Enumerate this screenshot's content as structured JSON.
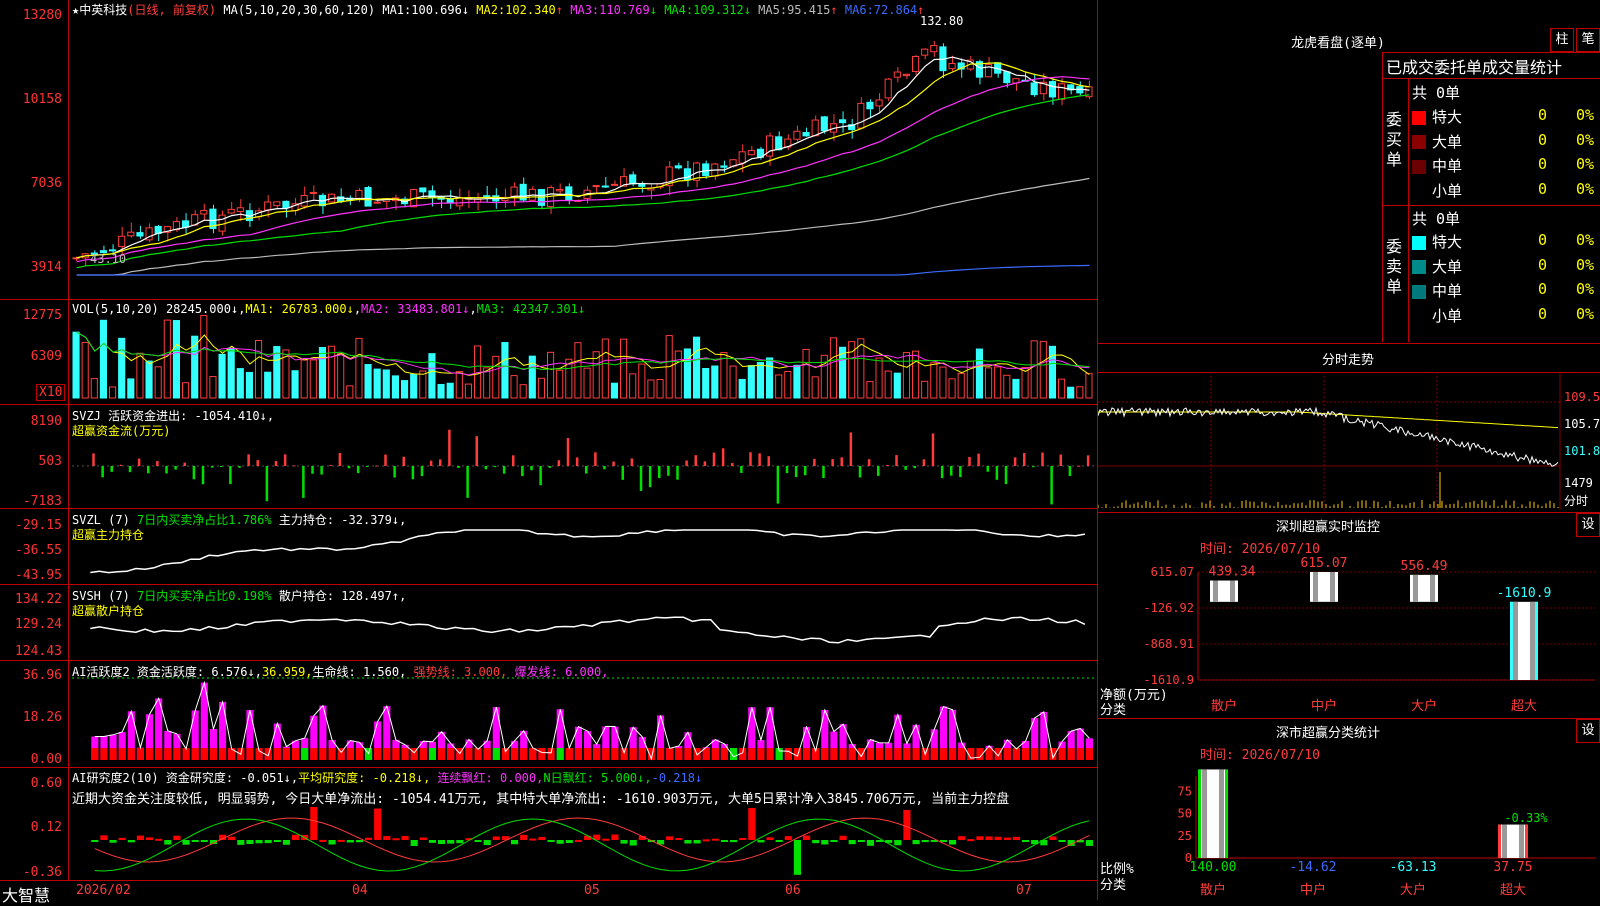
{
  "main": {
    "star": "★",
    "title": "中英科技",
    "period": "(日线, 前复权)",
    "ma_label": "MA(5,10,20,30,60,120)",
    "ma": [
      {
        "label": "MA1:",
        "value": "100.696",
        "arrow": "↓",
        "color": "#ffffff"
      },
      {
        "label": "MA2:",
        "value": "102.340",
        "arrow": "↑",
        "color": "#ffff00"
      },
      {
        "label": "MA3:",
        "value": "110.769",
        "arrow": "↓",
        "color": "#ff33ff"
      },
      {
        "label": "MA4:",
        "value": "109.312",
        "arrow": "↓",
        "color": "#00e000"
      },
      {
        "label": "MA5:",
        "value": "95.415",
        "arrow": "↑",
        "color": "#bbbbbb"
      },
      {
        "label": "MA6:",
        "value": "72.864",
        "arrow": "↑",
        "color": "#3b6bff"
      }
    ],
    "y_ticks": [
      "13280",
      "10158",
      "7036",
      "3914"
    ],
    "high_label": "132.80",
    "low_label": "43.10"
  },
  "vol": {
    "label": "VOL(5,10,20)",
    "value": "28245.000↓",
    "ma": [
      {
        "label": "MA1:",
        "value": "26783.000↓",
        "color": "#ffff00"
      },
      {
        "label": "MA2:",
        "value": "33483.801↓",
        "color": "#ff33ff"
      },
      {
        "label": "MA3:",
        "value": "42347.301↓",
        "color": "#00e000"
      }
    ],
    "y_ticks": [
      "12775",
      "6309"
    ],
    "unit": "X10"
  },
  "svzj": {
    "label": "SVZJ",
    "text": "活跃资金进出: -1054.410↓,",
    "sub": "超赢资金流(万元)",
    "y_ticks": [
      "8190",
      "503",
      "-7183"
    ]
  },
  "svzl": {
    "label": "SVZL (7)",
    "pct": "7日内买卖净占比1.786%",
    "hold": "主力持仓: -32.379↓,",
    "sub": "超赢主力持仓",
    "y_ticks": [
      "-29.15",
      "-36.55",
      "-43.95"
    ]
  },
  "svsh": {
    "label": "SVSH (7)",
    "pct": "7日内买卖净占比0.198%",
    "hold": "散户持仓: 128.497↑,",
    "sub": "超赢散户持仓",
    "y_ticks": [
      "134.22",
      "129.24",
      "124.43"
    ]
  },
  "ai1": {
    "label": "AI活跃度2",
    "text": "资金活跃度: 6.576↓,",
    "v2": "36.959,",
    "life": "生命线: 1.560,",
    "strong": "强势线: 3.000,",
    "burst": "爆发线: 6.000,",
    "y_ticks": [
      "36.96",
      "18.26",
      "0.00"
    ]
  },
  "ai2": {
    "label": "AI研究度2(10)",
    "t1": "资金研究度: -0.051↓,",
    "t2": "平均研究度: -0.218↓,",
    "t3": "连续飘红: 0.000,",
    "t4": "N日飘红: 5.000↓,",
    "t5": "-0.218↓",
    "comment": "近期大资金关注度较低, 明显弱势, 今日大单净流出: -1054.41万元, 其中特大单净流出: -1610.903万元, 大单5日累计净入3845.706万元, 当前主力控盘",
    "y_ticks": [
      "0.60",
      "0.12",
      "-0.36"
    ]
  },
  "xaxis": {
    "brand": "大智慧",
    "labels": [
      "2026/02",
      "04",
      "05",
      "06",
      "07"
    ]
  },
  "right": {
    "lhb": {
      "title": "龙虎看盘(逐单)",
      "btn1": "柱",
      "btn2": "笔",
      "header": "已成交委托单成交量统计",
      "buy": {
        "label": "委买单",
        "total": "共 0单",
        "rows": [
          {
            "name": "特大",
            "v": "0",
            "p": "0%",
            "color": "#ff0000"
          },
          {
            "name": "大单",
            "v": "0",
            "p": "0%",
            "color": "#8b0000"
          },
          {
            "name": "中单",
            "v": "0",
            "p": "0%",
            "color": "#6b0000"
          },
          {
            "name": "小单",
            "v": "0",
            "p": "0%",
            "color": "#000000"
          }
        ]
      },
      "sell": {
        "label": "委卖单",
        "total": "共 0单",
        "rows": [
          {
            "name": "特大",
            "v": "0",
            "p": "0%",
            "color": "#00ffff"
          },
          {
            "name": "大单",
            "v": "0",
            "p": "0%",
            "color": "#008b8b"
          },
          {
            "name": "中单",
            "v": "0",
            "p": "0%",
            "color": "#007a7a"
          },
          {
            "name": "小单",
            "v": "0",
            "p": "0%",
            "color": "#000000"
          }
        ]
      }
    },
    "fs": {
      "title": "分时走势",
      "ticks": [
        "109.5",
        "105.7",
        "101.8"
      ],
      "vol": "1479",
      "vol_unit": "分时"
    },
    "monitor": {
      "title": "深圳超赢实时监控",
      "btn": "设",
      "time": "时间: 2026/07/10",
      "y_ticks": [
        "615.07",
        "-126.92",
        "-868.91",
        "-1610.9"
      ],
      "y_unit": "净额(万元)",
      "x_unit": "分类",
      "bars": [
        {
          "name": "散户",
          "value": "439.34",
          "num": 439.34
        },
        {
          "name": "中户",
          "value": "615.07",
          "num": 615.07
        },
        {
          "name": "大户",
          "value": "556.49",
          "num": 556.49
        },
        {
          "name": "超大",
          "value": "-1610.9",
          "num": -1610.9
        }
      ]
    },
    "stats": {
      "title": "深市超赢分类统计",
      "btn": "设",
      "time": "时间: 2026/07/10",
      "y_ticks": [
        "75",
        "50",
        "25",
        "0"
      ],
      "y_unit": "比例%",
      "x_unit": "分类",
      "bars": [
        {
          "name": "散户",
          "value": "140.00",
          "num": 140.0,
          "color": "#00e000"
        },
        {
          "name": "中户",
          "value": "-14.62",
          "num": -14.62,
          "color": "#3b6bff"
        },
        {
          "name": "大户",
          "value": "-63.13",
          "num": -63.13,
          "color": "#33ffff"
        },
        {
          "name": "超大",
          "value": "37.75",
          "num": 37.75,
          "color": "#ff3c3c"
        }
      ],
      "annot": "-0.33%"
    }
  }
}
